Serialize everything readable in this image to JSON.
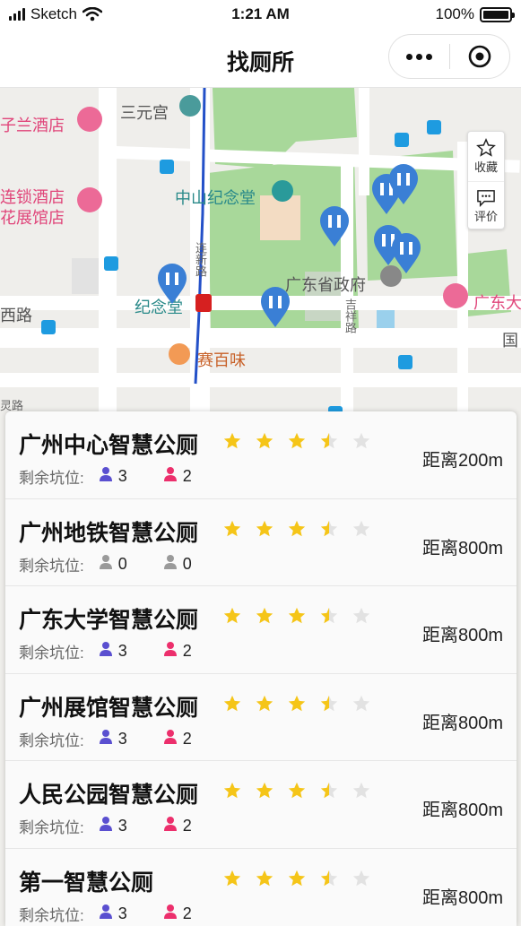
{
  "status_bar": {
    "carrier": "Sketch",
    "time": "1:21 AM",
    "battery": "100%",
    "battery_level": 1.0
  },
  "nav": {
    "title": "找厕所"
  },
  "map_labels": {
    "hotel1": "子兰酒店",
    "sanyuangong": "三元宫",
    "hotel2_line1": "连锁酒店",
    "hotel2_line2": "花展馆店",
    "zhongshan": "中山纪念堂",
    "gov": "广东省政府",
    "jiniantang": "纪念堂",
    "xilu": "西路",
    "saibaiwei": "赛百味",
    "guangdong_right": "广东大",
    "lianxinlu": "连新路",
    "jixianglu": "吉祥路",
    "lingyuanlu": "灵路",
    "guo": "国"
  },
  "side_tools": {
    "favorite": "收藏",
    "review": "评价"
  },
  "remain_label": "剩余坑位:",
  "colors": {
    "star": "#f5c518",
    "star_empty": "#e2e2e2",
    "male": "#5a4fd0",
    "female": "#ec2f6c",
    "disabled": "#9a9a9a",
    "pin": "#3a7fd5"
  },
  "toilets": [
    {
      "name": "广州中心智慧公厕",
      "rating": 3.5,
      "distance": "距离200m",
      "male": "3",
      "female": "2",
      "available": true
    },
    {
      "name": "广州地铁智慧公厕",
      "rating": 3.5,
      "distance": "距离800m",
      "male": "0",
      "female": "0",
      "available": false
    },
    {
      "name": "广东大学智慧公厕",
      "rating": 3.5,
      "distance": "距离800m",
      "male": "3",
      "female": "2",
      "available": true
    },
    {
      "name": "广州展馆智慧公厕",
      "rating": 3.5,
      "distance": "距离800m",
      "male": "3",
      "female": "2",
      "available": true
    },
    {
      "name": "人民公园智慧公厕",
      "rating": 3.5,
      "distance": "距离800m",
      "male": "3",
      "female": "2",
      "available": true
    },
    {
      "name": "第一智慧公厕",
      "rating": 3.5,
      "distance": "距离800m",
      "male": "3",
      "female": "2",
      "available": true
    }
  ]
}
